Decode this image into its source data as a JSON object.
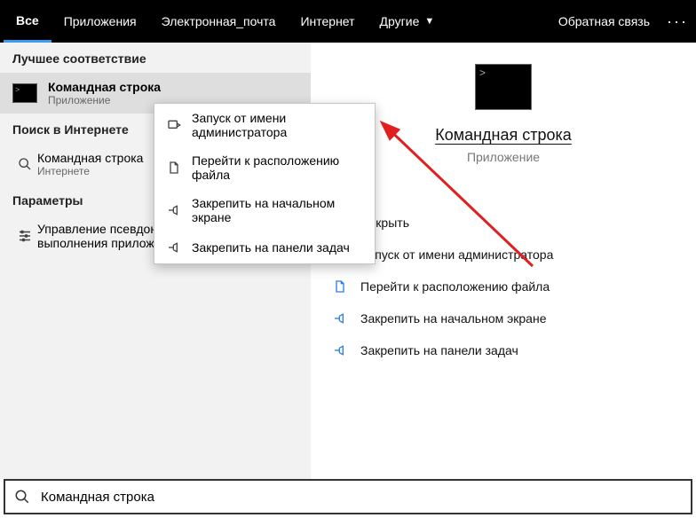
{
  "tabs": {
    "all": "Все",
    "apps": "Приложения",
    "email": "Электронная_почта",
    "internet": "Интернет",
    "other": "Другие"
  },
  "header": {
    "feedback": "Обратная связь"
  },
  "left": {
    "best_match": "Лучшее соответствие",
    "result1": {
      "title": "Командная строка",
      "sub": "Приложение"
    },
    "web_header": "Поиск в Интернете",
    "web1": {
      "title": "Командная строка",
      "sub": "Интернете"
    },
    "params_header": "Параметры",
    "param1": "Управление псевдонимами выполнения приложения"
  },
  "context_menu": {
    "run_admin": "Запуск от имени администратора",
    "open_location": "Перейти к расположению файла",
    "pin_start": "Закрепить на начальном экране",
    "pin_taskbar": "Закрепить на панели задач"
  },
  "preview": {
    "title": "Командная строка",
    "sub": "Приложение"
  },
  "actions": {
    "open": "Открыть",
    "run_admin": "Запуск от имени администратора",
    "open_location": "Перейти к расположению файла",
    "pin_start": "Закрепить на начальном экране",
    "pin_taskbar": "Закрепить на панели задач"
  },
  "search": {
    "value": "Командная строка"
  }
}
